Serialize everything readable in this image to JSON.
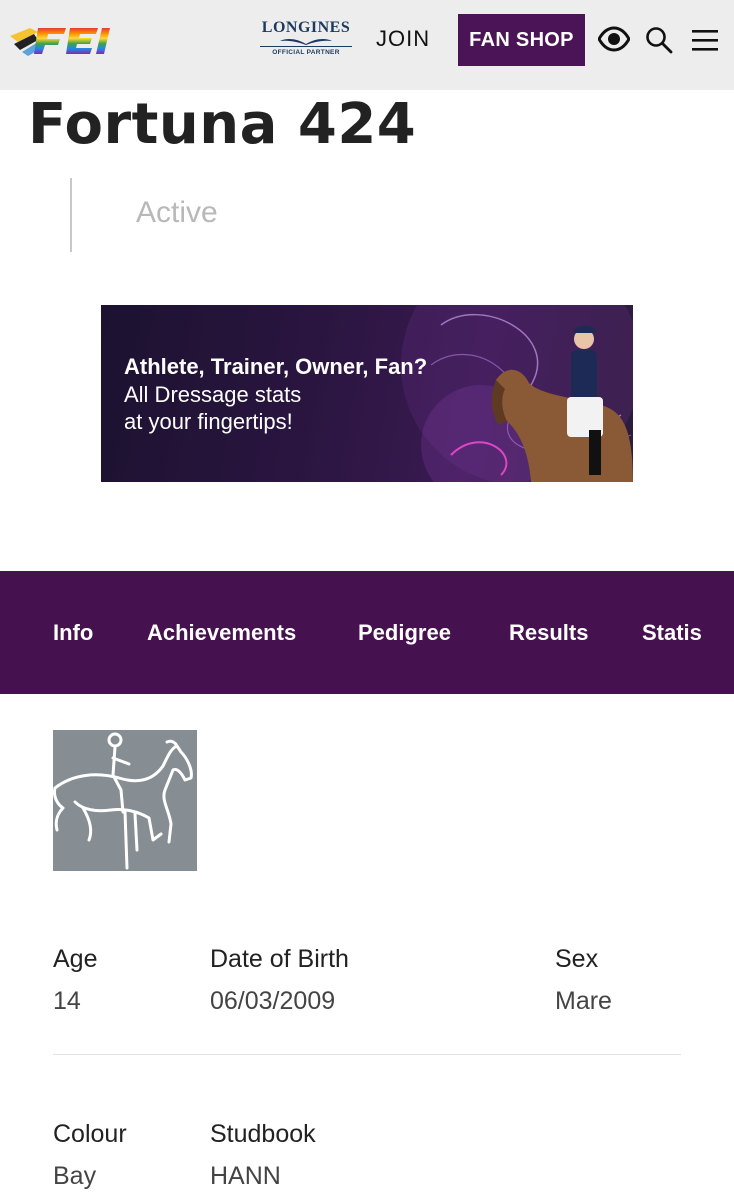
{
  "header": {
    "logo_icon": "fei-logo-rainbow",
    "partner_brand": "LONGINES",
    "partner_caption": "OFFICIAL PARTNER",
    "join_label": "JOIN",
    "fanshop_label": "FAN SHOP",
    "icons": [
      "eye-icon",
      "search-icon",
      "menu-icon"
    ]
  },
  "horse": {
    "name": "Fortuna 424",
    "status": "Active"
  },
  "banner": {
    "line1": "Athlete, Trainer, Owner, Fan?",
    "line2": "All Dressage stats",
    "line3": "at your fingertips!"
  },
  "tabs": [
    "Info",
    "Achievements",
    "Pedigree",
    "Results",
    "Statis"
  ],
  "details": {
    "age_label": "Age",
    "age_value": "14",
    "dob_label": "Date of Birth",
    "dob_value": "06/03/2009",
    "sex_label": "Sex",
    "sex_value": "Mare",
    "colour_label": "Colour",
    "colour_value": "Bay",
    "studbook_label": "Studbook",
    "studbook_value": "HANN"
  },
  "colors": {
    "brand_purple": "#45114f",
    "fanshop_bg": "#4a1456",
    "header_bg": "#ededed"
  }
}
